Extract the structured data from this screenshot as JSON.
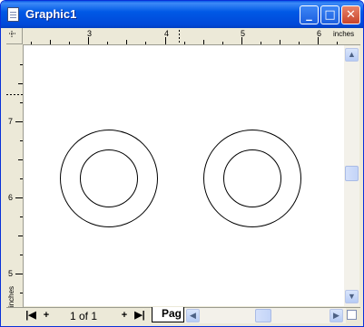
{
  "window": {
    "title": "Graphic1",
    "buttons": {
      "minimize": "_",
      "maximize": "□",
      "close": "✕"
    }
  },
  "ruler_top": {
    "unit": "inches",
    "ticks": [
      "3",
      "4",
      "5",
      "6"
    ]
  },
  "ruler_left": {
    "unit": "inches",
    "ticks": [
      "7",
      "6",
      "5"
    ]
  },
  "shapes": [
    {
      "type": "ring",
      "label": "left-ring"
    },
    {
      "type": "ring",
      "label": "right-ring"
    }
  ],
  "bottom": {
    "first": "|◀",
    "add_before": "+",
    "page_info": "1 of 1",
    "add_after": "+",
    "last": "▶|",
    "page_tab": "Pag"
  },
  "scroll": {
    "up": "▲",
    "down": "▼",
    "left": "◀",
    "right": "▶"
  },
  "colors": {
    "titlebar": "#0054e3",
    "chrome": "#ece9d8",
    "close": "#c8442a"
  }
}
